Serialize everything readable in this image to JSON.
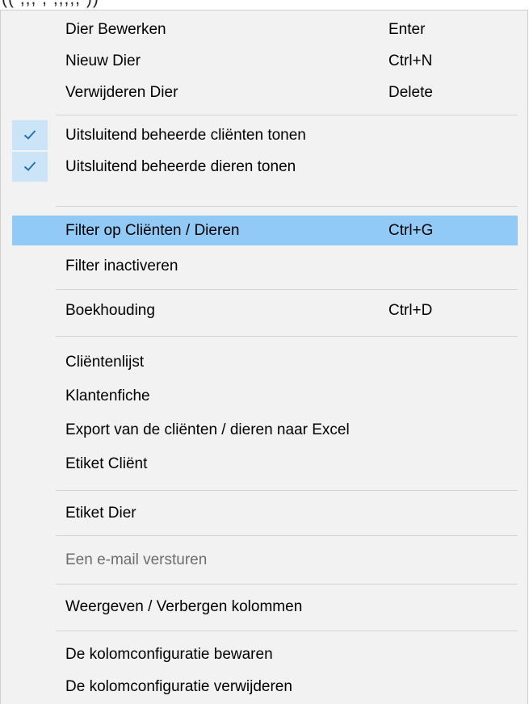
{
  "menu": {
    "items": [
      {
        "label": "Dier Bewerken",
        "shortcut": "Enter"
      },
      {
        "label": "Nieuw Dier",
        "shortcut": "Ctrl+N"
      },
      {
        "label": "Verwijderen Dier",
        "shortcut": "Delete"
      },
      {
        "label": "Uitsluitend beheerde cliënten tonen",
        "checked": true
      },
      {
        "label": "Uitsluitend beheerde dieren tonen",
        "checked": true
      },
      {
        "label": "Filter op Cliënten / Dieren",
        "shortcut": "Ctrl+G",
        "highlighted": true
      },
      {
        "label": "Filter inactiveren"
      },
      {
        "label": "Boekhouding",
        "shortcut": "Ctrl+D"
      },
      {
        "label": "Cliëntenlijst"
      },
      {
        "label": "Klantenfiche"
      },
      {
        "label": "Export van de cliënten / dieren naar Excel"
      },
      {
        "label": "Etiket Cliënt"
      },
      {
        "label": "Etiket Dier"
      },
      {
        "label": "Een e-mail versturen",
        "disabled": true
      },
      {
        "label": "Weergeven / Verbergen kolommen"
      },
      {
        "label": "De kolomconfiguratie bewaren"
      },
      {
        "label": "De kolomconfiguratie verwijderen"
      }
    ]
  },
  "icons": {
    "check": "checkmark-icon"
  },
  "colors": {
    "menu_background": "#f2f2f2",
    "highlight": "#91c9f7",
    "check_background": "#cce4f7",
    "check_mark": "#2b6fb0",
    "disabled_text": "#6d6d6d",
    "separator": "#d3d3d3"
  }
}
